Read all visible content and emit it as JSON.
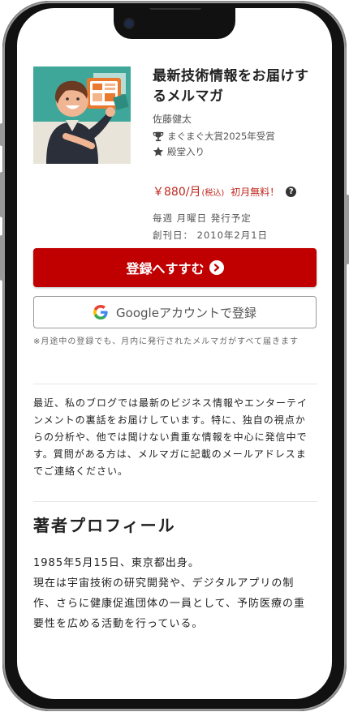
{
  "newsletter": {
    "title": "最新技術情報をお届けするメルマガ",
    "author": "佐藤健太",
    "award": "まぐまぐ大賞2025年受賞",
    "hall_of_fame": "殿堂入り",
    "price": "￥880/月",
    "price_tax": "(税込)",
    "price_free": "初月無料！",
    "schedule": "毎週 月曜日 発行予定",
    "founded": "創刊日： 2010年2月1日"
  },
  "actions": {
    "subscribe_label": "登録へすすむ",
    "google_label": "Googleアカウントで登録"
  },
  "note": "※月途中の登録でも、月内に発行されたメルマガがすべて届きます",
  "description": "最近、私のブログでは最新のビジネス情報やエンターテインメントの裏話をお届けしています。特に、独自の視点からの分析や、他では聞けない貴重な情報を中心に発信中です。質問がある方は、メルマガに記載のメールアドレスまでご連絡ください。",
  "profile": {
    "heading": "著者プロフィール",
    "line1": "1985年5月15日、東京都出身。",
    "line2": "現在は宇宙技術の研究開発や、デジタルアプリの制作、さらに健康促進団体の一員として、予防医療の重要性を広める活動を行っている。"
  },
  "colors": {
    "accent": "#c00000",
    "price": "#c0281f",
    "cover_bg": "#3fa79a"
  },
  "icons": [
    "trophy-icon",
    "star-icon",
    "chevron-right-icon",
    "help-icon",
    "google-logo-icon"
  ]
}
